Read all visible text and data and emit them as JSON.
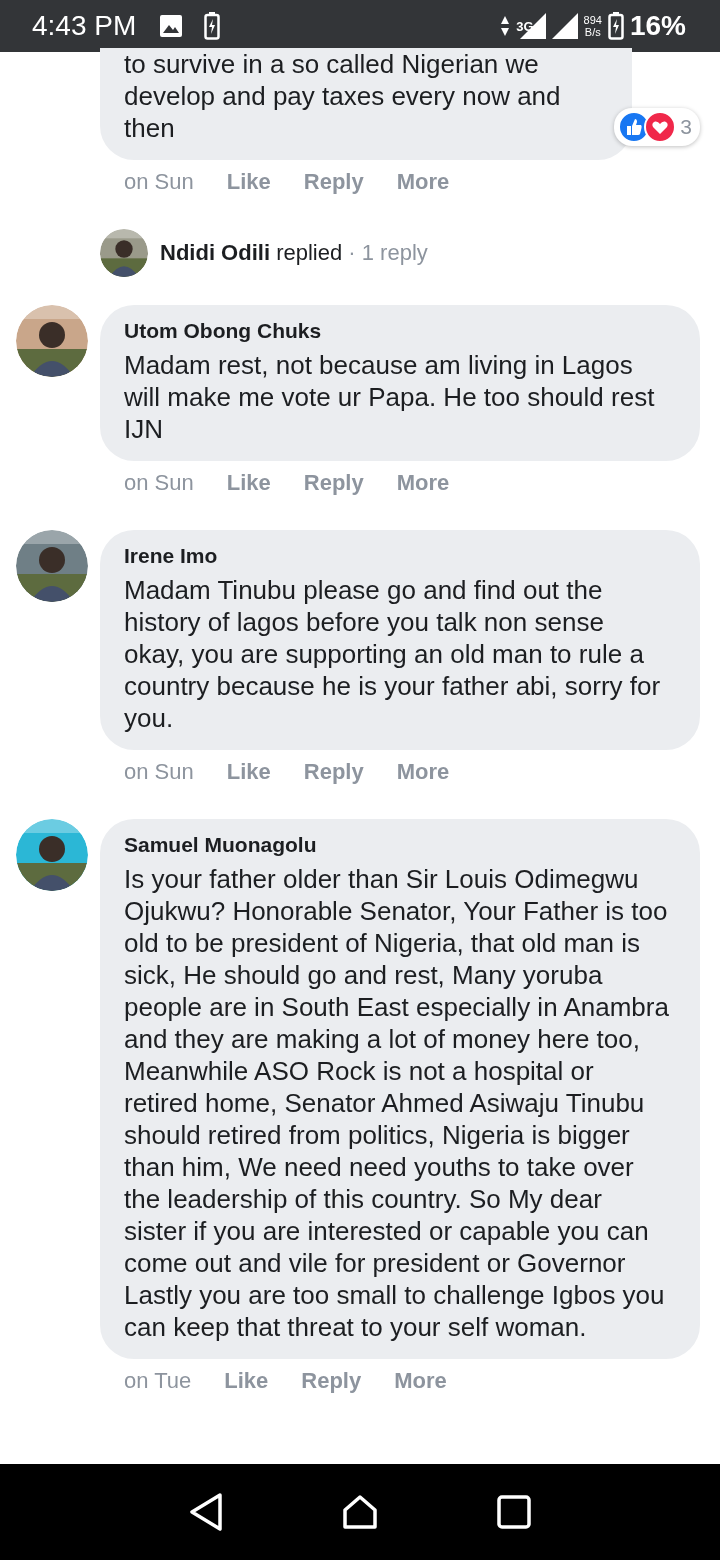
{
  "status_bar": {
    "time": "4:43 PM",
    "network": "3G",
    "speed": "894",
    "speed_unit": "B/s",
    "battery": "16%"
  },
  "partial_comment": {
    "text": "to survive in a so called Nigerian we develop and pay taxes every now and then",
    "reactions": {
      "count": "3"
    },
    "time": "on Sun",
    "actions": [
      "Like",
      "Reply",
      "More"
    ]
  },
  "reply_summary": {
    "author": "Ndidi Odili",
    "verb": "replied",
    "count": "· 1 reply"
  },
  "comments": [
    {
      "author": "Utom Obong Chuks",
      "text": "Madam rest, not because am living in Lagos will make me vote ur Papa. He too should rest IJN",
      "time": "on Sun",
      "actions": [
        "Like",
        "Reply",
        "More"
      ]
    },
    {
      "author": "Irene Imo",
      "text": "Madam Tinubu please go and find out the history of lagos before you talk non sense okay, you are supporting an old man to rule a country because he is your father abi, sorry for you.",
      "time": "on Sun",
      "actions": [
        "Like",
        "Reply",
        "More"
      ]
    },
    {
      "author": "Samuel Muonagolu",
      "text": "Is your father older than Sir Louis Odimegwu Ojukwu? Honorable Senator, Your Father is too old to be president of Nigeria, that old man is sick, He should go and rest, Many yoruba people are in South East especially in Anambra and they are making a lot of money here too, Meanwhile ASO Rock is not a hospital or retired home, Senator Ahmed Asiwaju Tinubu should retired from politics, Nigeria is bigger than him, We need need youths to take over the leadership of this country. So My dear sister if you are interested or capable you can come out and vile for president or Governor Lastly you are too small to challenge Igbos you can keep that threat to your self woman.",
      "time": "on Tue",
      "actions": [
        "Like",
        "Reply",
        "More"
      ]
    }
  ]
}
